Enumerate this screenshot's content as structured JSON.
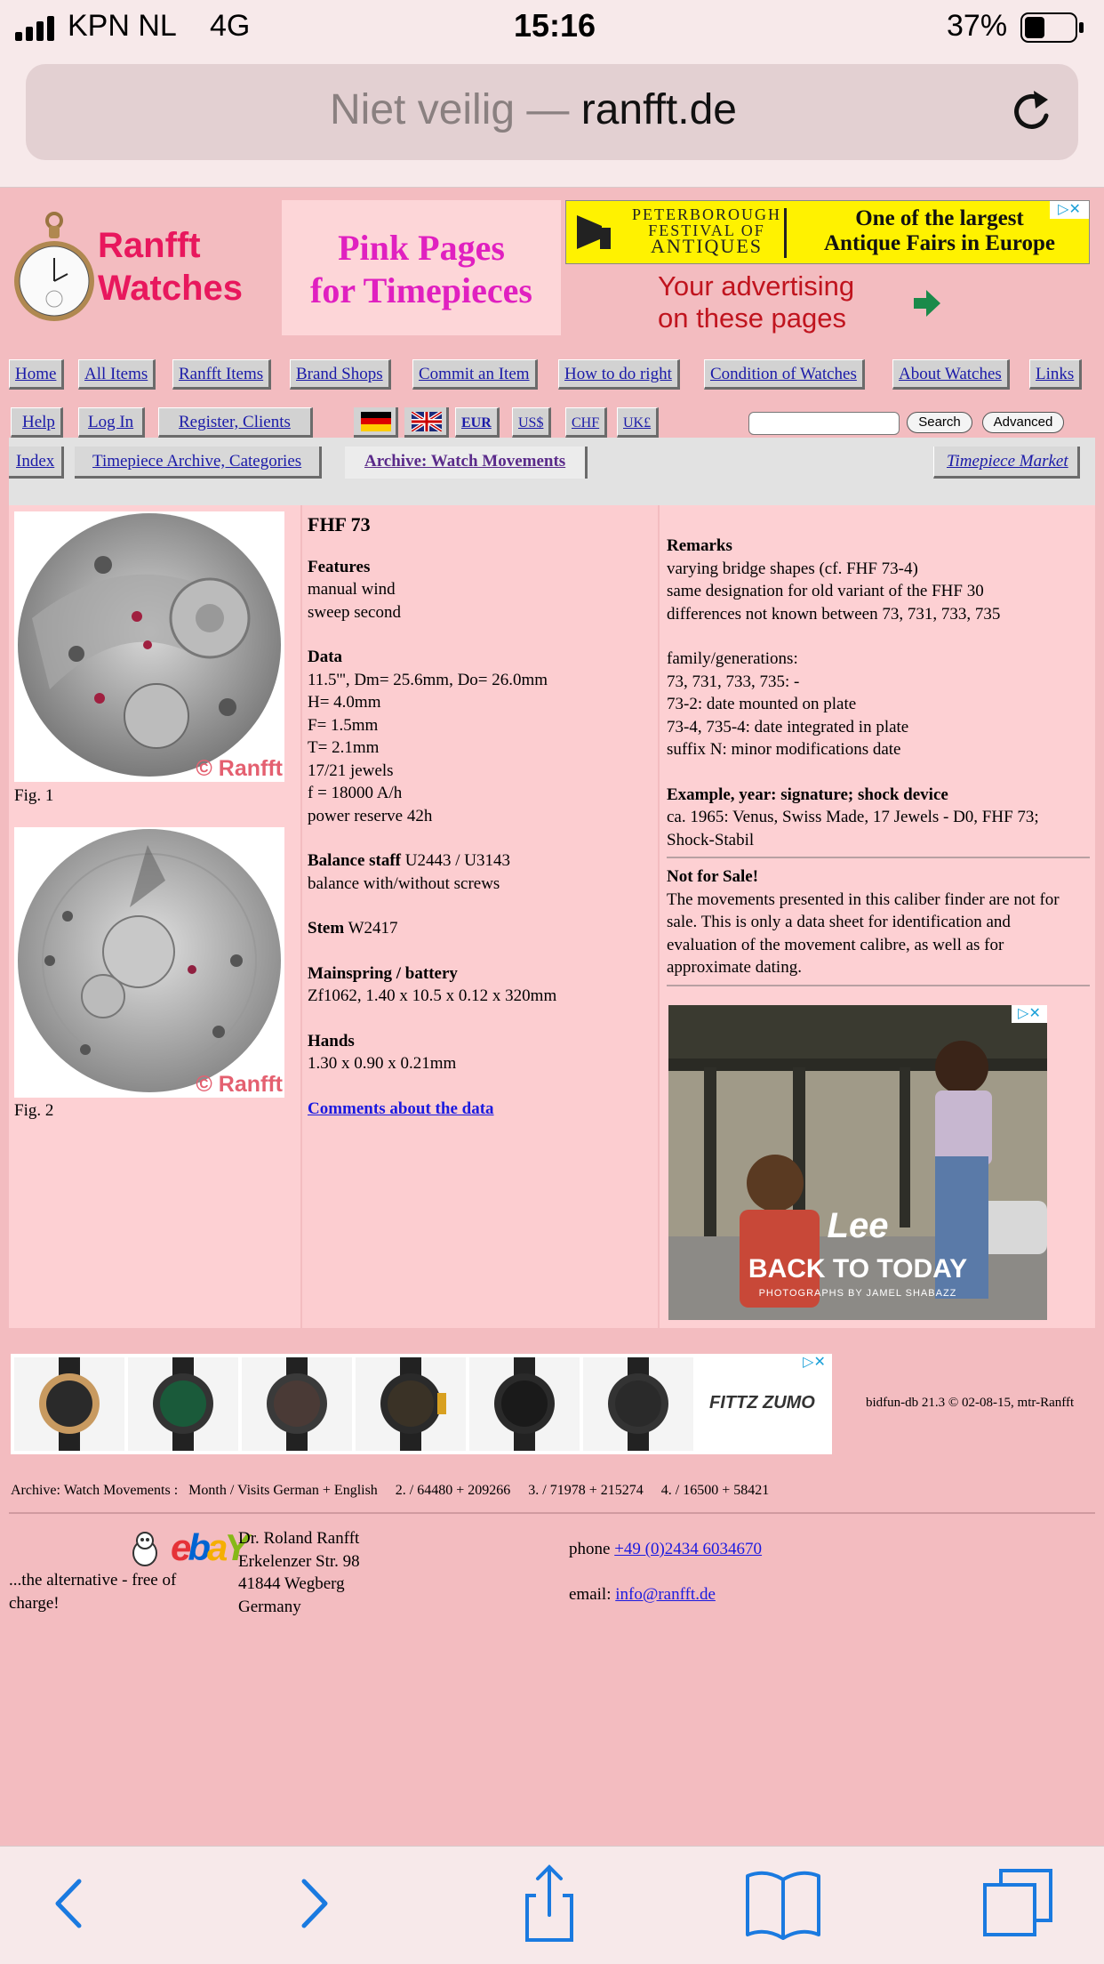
{
  "status": {
    "carrier": "KPN NL",
    "network": "4G",
    "time": "15:16",
    "battery": "37%"
  },
  "browser": {
    "url_prefix": "Niet veilig — ",
    "url_domain": "ranfft.de"
  },
  "header": {
    "logo_line1": "Ranfft",
    "logo_line2": "Watches",
    "pink_line1": "Pink Pages",
    "pink_line2": "for Timepieces",
    "ad_top_left1": "PETERBOROUGH",
    "ad_top_left2": "FESTIVAL OF",
    "ad_top_left3": "ANTIQUES",
    "ad_top_right1": "One of the largest",
    "ad_top_right2": "Antique Fairs in Europe",
    "ad_own1": "Your advertising",
    "ad_own2": "on these pages"
  },
  "nav": {
    "row1": [
      "Home",
      "All Items",
      "Ranfft Items",
      "Brand Shops",
      "Commit an Item",
      "How to do right",
      "Condition of Watches",
      "About Watches",
      "Links"
    ],
    "row2": [
      "Help",
      "Log In",
      "Register, Clients"
    ],
    "currencies": [
      "EUR",
      "US$",
      "CHF",
      "UK£"
    ],
    "search_button": "Search",
    "advanced_button": "Advanced",
    "tabs": [
      "Index",
      "Timepiece Archive, Categories",
      "Archive: Watch Movements",
      "Timepiece Market"
    ]
  },
  "figures": {
    "fig1": "Fig. 1",
    "fig2": "Fig. 2",
    "watermark": "© Ranfft"
  },
  "movement": {
    "title": "FHF 73",
    "features_h": "Features",
    "features": [
      "manual wind",
      "sweep second"
    ],
    "data_h": "Data",
    "data": [
      "11.5''', Dm= 25.6mm, Do= 26.0mm",
      "H= 4.0mm",
      "F= 1.5mm",
      "T= 2.1mm",
      "17/21 jewels",
      "f = 18000 A/h",
      "power reserve 42h"
    ],
    "balance_h": "Balance staff",
    "balance_v": "U2443 / U3143",
    "balance_note": "balance with/without screws",
    "stem_h": "Stem",
    "stem_v": "W2417",
    "mainspring_h": "Mainspring / battery",
    "mainspring_v": "Zf1062, 1.40 x 10.5 x 0.12 x 320mm",
    "hands_h": "Hands",
    "hands_v": "1.30 x 0.90 x 0.21mm",
    "comments_link": "Comments about the data"
  },
  "remarks": {
    "remarks_h": "Remarks",
    "remarks": [
      "varying bridge shapes (cf. FHF 73-4)",
      "same designation for old variant of the FHF 30",
      "differences not known between 73, 731, 733, 735"
    ],
    "family": [
      "family/generations:",
      "73, 731, 733, 735: -",
      "73-2: date mounted on plate",
      "73-4, 735-4: date integrated in plate",
      "suffix N: minor modifications date"
    ],
    "example_h": "Example, year: signature; shock device",
    "example": [
      "ca. 1965: Venus, Swiss Made, 17 Jewels - D0, FHF 73;",
      "Shock-Stabil"
    ],
    "notsale_h": "Not for Sale!",
    "notsale": [
      "The movements presented in this caliber finder are not for",
      "sale. This is only a data sheet for identification and",
      "evaluation of the movement calibre, as well as for",
      "approximate dating."
    ],
    "ad_brand": "Lee",
    "ad_slogan": "BACK TO TODAY",
    "ad_credit": "PHOTOGRAPHS BY JAMEL SHABAZZ"
  },
  "footer": {
    "watch_ad_brand": "FITTZ ZUMO",
    "db_note": "bidfun-db 21.3 © 02-08-15, mtr-Ranfft",
    "stats": "Archive: Watch Movements :   Month / Visits German + English     2. / 64480 + 209266     3. / 71978 + 215274     4. / 16500 + 58421",
    "ebay_tag1": "...the alternative - free of",
    "ebay_tag2": "charge!",
    "address": [
      "Dr. Roland Ranfft",
      "Erkelenzer Str. 98",
      "41844 Wegberg",
      "Germany"
    ],
    "phone_label": "phone",
    "phone": "+49 (0)2434 6034670",
    "email_label": "email:",
    "email": "info@ranfft.de"
  },
  "colors": {
    "page_bg": "#f3bcc0",
    "content_bg": "#fdd0d3",
    "nav_link": "#1a1aa8",
    "logo": "#e8175d",
    "pink_title": "#e020c0"
  },
  "icons": [
    "signal-icon",
    "battery-icon",
    "reload-icon",
    "back-icon",
    "forward-icon",
    "share-icon",
    "bookmarks-icon",
    "tabs-icon"
  ]
}
